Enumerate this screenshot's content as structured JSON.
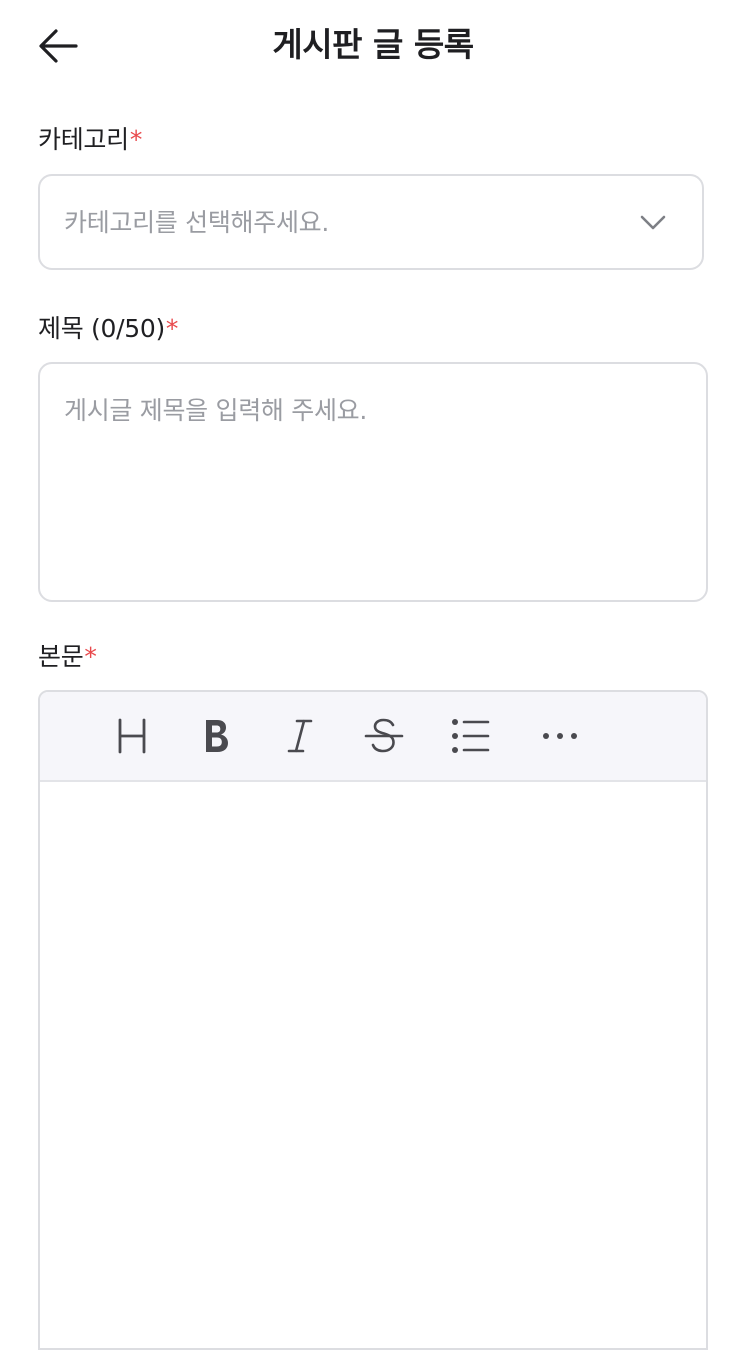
{
  "header": {
    "title": "게시판 글 등록",
    "back_icon": "arrow-left-icon"
  },
  "category": {
    "label": "카테고리",
    "required_mark": "*",
    "placeholder": "카테고리를 선택해주세요.",
    "dropdown_icon": "chevron-down-icon"
  },
  "title_field": {
    "label": "제목 (0/50)",
    "required_mark": "*",
    "placeholder": "게시글 제목을 입력해 주세요.",
    "value": ""
  },
  "body_field": {
    "label": "본문",
    "required_mark": "*",
    "toolbar": [
      {
        "name": "heading",
        "icon": "heading-icon"
      },
      {
        "name": "bold",
        "icon": "bold-icon"
      },
      {
        "name": "italic",
        "icon": "italic-icon"
      },
      {
        "name": "strikethrough",
        "icon": "strikethrough-icon"
      },
      {
        "name": "bullet-list",
        "icon": "bullet-list-icon"
      },
      {
        "name": "more",
        "icon": "more-horizontal-icon"
      }
    ],
    "value": ""
  },
  "colors": {
    "required": "#e8484b",
    "placeholder": "#9a9ca2",
    "border": "#dcdde1",
    "toolbar_bg": "#f6f6fa"
  }
}
